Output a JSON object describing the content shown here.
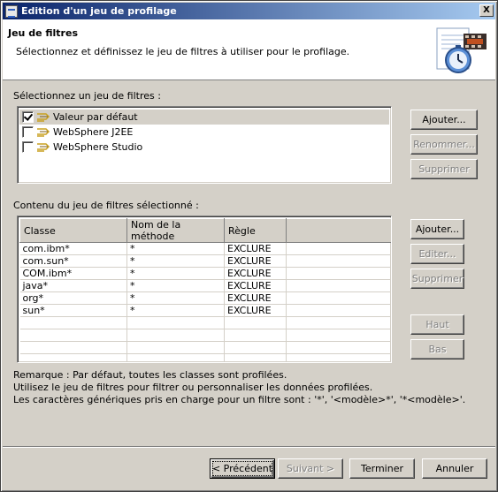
{
  "window": {
    "title": "Edition d'un jeu de profilage",
    "close_label": "X"
  },
  "banner": {
    "title": "Jeu de filtres",
    "description": "Sélectionnez et définissez le jeu de filtres à utiliser pour le profilage."
  },
  "filter_sets": {
    "label": "Sélectionnez un jeu de filtres :",
    "items": [
      {
        "label": "Valeur par défaut",
        "checked": true,
        "selected": true
      },
      {
        "label": "WebSphere J2EE",
        "checked": false,
        "selected": false
      },
      {
        "label": "WebSphere Studio",
        "checked": false,
        "selected": false
      }
    ],
    "buttons": {
      "add": "Ajouter...",
      "rename": "Renommer...",
      "delete": "Supprimer"
    }
  },
  "filter_contents": {
    "label": "Contenu du jeu de filtres sélectionné :",
    "columns": [
      "Classe",
      "Nom de la méthode",
      "Règle"
    ],
    "rows": [
      [
        "com.ibm*",
        "*",
        "EXCLURE"
      ],
      [
        "com.sun*",
        "*",
        "EXCLURE"
      ],
      [
        "COM.ibm*",
        "*",
        "EXCLURE"
      ],
      [
        "java*",
        "*",
        "EXCLURE"
      ],
      [
        "org*",
        "*",
        "EXCLURE"
      ],
      [
        "sun*",
        "*",
        "EXCLURE"
      ]
    ],
    "buttons": {
      "add": "Ajouter...",
      "edit": "Editer...",
      "delete": "Supprimer",
      "up": "Haut",
      "down": "Bas"
    }
  },
  "notes": [
    "Remarque : Par défaut, toutes les classes sont profilées.",
    "Utilisez le jeu de filtres pour filtrer ou personnaliser les données profilées.",
    "Les caractères génériques pris en charge pour un filtre sont : '*', '<modèle>*', '*<modèle>'."
  ],
  "footer": {
    "back": "< Précédent",
    "next": "Suivant >",
    "finish": "Terminer",
    "cancel": "Annuler"
  },
  "colors": {
    "title_bar_start": "#0a246a",
    "title_bar_end": "#a6caf0",
    "face": "#d4d0c8"
  }
}
